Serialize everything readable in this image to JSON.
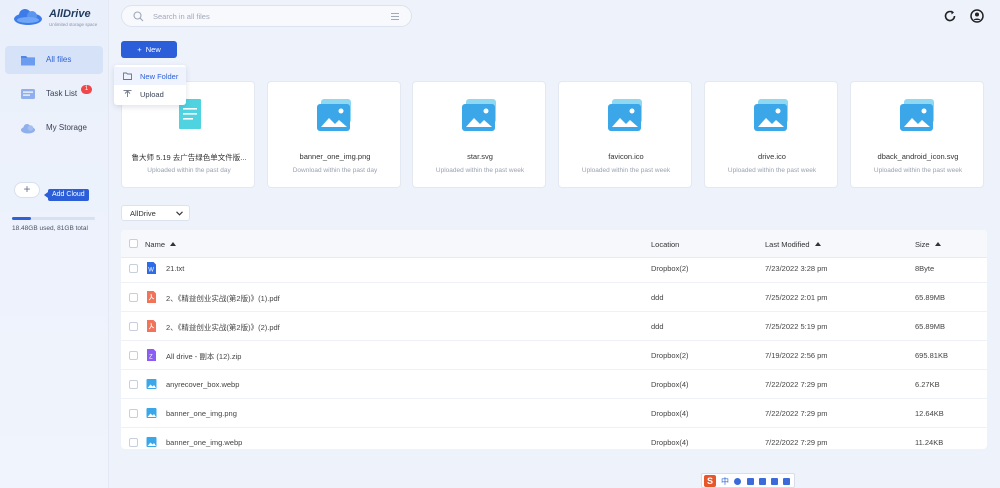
{
  "brand": {
    "name": "AllDrive",
    "tagline": "Unlimited storage space"
  },
  "sidebar": {
    "items": [
      {
        "label": "All files",
        "icon": "folder-icon",
        "active": true
      },
      {
        "label": "Task List",
        "icon": "task-list-icon",
        "badge": "1"
      },
      {
        "label": "My Storage",
        "icon": "cloud-icon"
      }
    ],
    "add_cloud_label": "Add Cloud",
    "storage": {
      "used_fraction": 0.23,
      "text": "18.48GB used, 81GB total"
    }
  },
  "search": {
    "placeholder": "Search in all files"
  },
  "toolbar": {
    "new_label": "New",
    "menu": [
      {
        "label": "New Folder",
        "icon": "folder-outline-icon",
        "highlighted": true
      },
      {
        "label": "Upload",
        "icon": "upload-icon"
      }
    ]
  },
  "recent": [
    {
      "name": "鲁大师 5.19 去广告绿色单文件版...",
      "meta": "Uploaded within the past day",
      "icon": "document-icon"
    },
    {
      "name": "banner_one_img.png",
      "meta": "Download within the past day",
      "icon": "image-icon"
    },
    {
      "name": "star.svg",
      "meta": "Uploaded within the past week",
      "icon": "image-icon"
    },
    {
      "name": "favicon.ico",
      "meta": "Uploaded within the past week",
      "icon": "image-icon"
    },
    {
      "name": "drive.ico",
      "meta": "Uploaded within the past week",
      "icon": "image-icon"
    },
    {
      "name": "dback_android_icon.svg",
      "meta": "Uploaded within the past week",
      "icon": "image-icon"
    }
  ],
  "filter": {
    "selected": "AllDrive"
  },
  "table": {
    "headers": {
      "name": "Name",
      "location": "Location",
      "modified": "Last Modified",
      "size": "Size"
    },
    "rows": [
      {
        "icon": "word-file-icon",
        "name": "21.txt",
        "location": "Dropbox(2)",
        "modified": "7/23/2022 3:28 pm",
        "size": "8Byte"
      },
      {
        "icon": "pdf-file-icon",
        "name": "2、《精益创业实战(第2版)》(1).pdf",
        "location": "ddd",
        "modified": "7/25/2022 2:01 pm",
        "size": "65.89MB"
      },
      {
        "icon": "pdf-file-icon",
        "name": "2、《精益创业实战(第2版)》(2).pdf",
        "location": "ddd",
        "modified": "7/25/2022 5:19 pm",
        "size": "65.89MB"
      },
      {
        "icon": "zip-file-icon",
        "name": "All drive - 副本 (12).zip",
        "location": "Dropbox(2)",
        "modified": "7/19/2022 2:56 pm",
        "size": "695.81KB"
      },
      {
        "icon": "image-file-icon",
        "name": "anyrecover_box.webp",
        "location": "Dropbox(4)",
        "modified": "7/22/2022 7:29 pm",
        "size": "6.27KB"
      },
      {
        "icon": "image-file-icon",
        "name": "banner_one_img.png",
        "location": "Dropbox(4)",
        "modified": "7/22/2022 7:29 pm",
        "size": "12.64KB"
      },
      {
        "icon": "image-file-icon",
        "name": "banner_one_img.webp",
        "location": "Dropbox(4)",
        "modified": "7/22/2022 7:29 pm",
        "size": "11.24KB"
      }
    ]
  },
  "ime": {
    "logo": "S",
    "lang": "中"
  },
  "colors": {
    "accent": "#2B5ED8",
    "badge": "#F04848",
    "pdf": "#F0735A",
    "zip": "#8B5CF6",
    "word": "#2E6BE6",
    "image": "#3BA7E8"
  }
}
